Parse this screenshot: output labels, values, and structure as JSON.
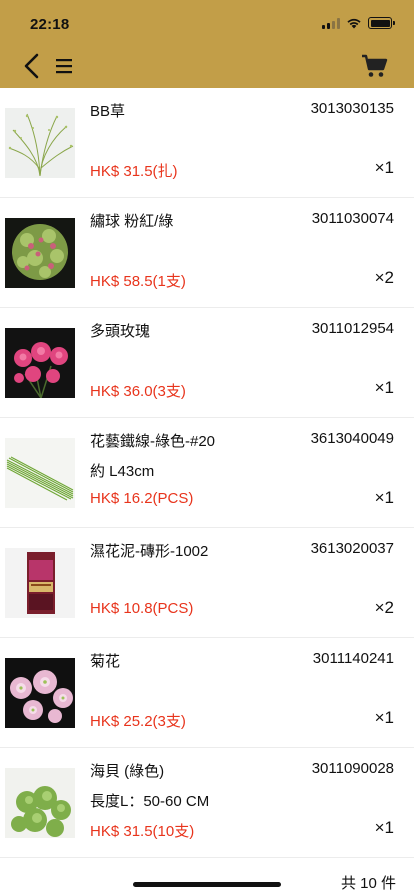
{
  "status_bar": {
    "time": "22:18"
  },
  "header": {
    "back_icon": "chevron-left-icon",
    "menu_icon": "hamburger-menu-icon",
    "cart_icon": "shopping-cart-icon"
  },
  "items": [
    {
      "name": "BB草",
      "spec": "",
      "code": "3013030135",
      "price": "HK$ 31.5(扎)",
      "qty": "×1",
      "image": "bb-grass-image"
    },
    {
      "name": "繡球 粉紅/綠",
      "spec": "",
      "code": "3011030074",
      "price": "HK$ 58.5(1支)",
      "qty": "×2",
      "image": "hydrangea-image"
    },
    {
      "name": "多頭玫瑰",
      "spec": "",
      "code": "3011012954",
      "price": "HK$ 36.0(3支)",
      "qty": "×1",
      "image": "spray-rose-image"
    },
    {
      "name": "花藝鐵線-綠色-#20",
      "spec": "約 L43cm",
      "code": "3613040049",
      "price": "HK$ 16.2(PCS)",
      "qty": "×1",
      "image": "floral-wire-image"
    },
    {
      "name": "濕花泥-磚形-1002",
      "spec": "",
      "code": "3613020037",
      "price": "HK$ 10.8(PCS)",
      "qty": "×2",
      "image": "floral-foam-image"
    },
    {
      "name": "菊花",
      "spec": "",
      "code": "3011140241",
      "price": "HK$ 25.2(3支)",
      "qty": "×1",
      "image": "chrysanthemum-image"
    },
    {
      "name": "海貝 (綠色)",
      "spec": "長度L：50-60 CM",
      "code": "3011090028",
      "price": "HK$ 31.5(10支)",
      "qty": "×1",
      "image": "bells-of-ireland-image"
    }
  ],
  "footer": {
    "total_label": "共 10 件"
  },
  "colors": {
    "header_bg": "#c29e48",
    "price": "#e8341c"
  }
}
